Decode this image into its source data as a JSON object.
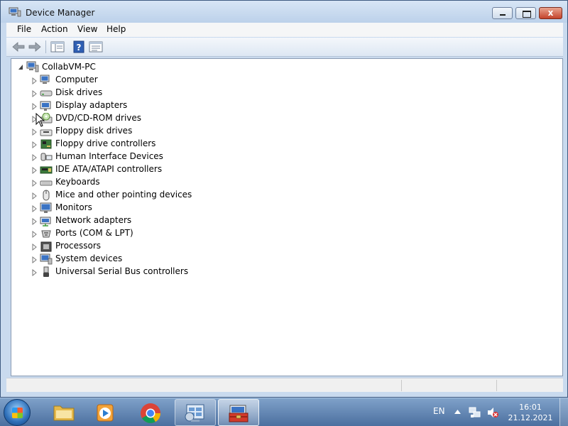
{
  "window": {
    "title": "Device Manager",
    "close_glyph": "x"
  },
  "menubar": {
    "items": [
      "File",
      "Action",
      "View",
      "Help"
    ]
  },
  "toolbar": {
    "icons": [
      "back-arrow-icon",
      "forward-arrow-icon",
      "show-hide-tree-icon",
      "help-icon",
      "properties-icon"
    ]
  },
  "tree": {
    "root": {
      "label": "CollabVM-PC",
      "icon": "computer-icon",
      "expanded": true
    },
    "categories": [
      {
        "label": "Computer",
        "icon": "computer-icon"
      },
      {
        "label": "Disk drives",
        "icon": "disk-drive-icon"
      },
      {
        "label": "Display adapters",
        "icon": "display-adapter-icon"
      },
      {
        "label": "DVD/CD-ROM drives",
        "icon": "dvd-drive-icon"
      },
      {
        "label": "Floppy disk drives",
        "icon": "floppy-disk-icon"
      },
      {
        "label": "Floppy drive controllers",
        "icon": "floppy-controller-icon"
      },
      {
        "label": "Human Interface Devices",
        "icon": "hid-icon"
      },
      {
        "label": "IDE ATA/ATAPI controllers",
        "icon": "ide-controller-icon"
      },
      {
        "label": "Keyboards",
        "icon": "keyboard-icon"
      },
      {
        "label": "Mice and other pointing devices",
        "icon": "mouse-icon"
      },
      {
        "label": "Monitors",
        "icon": "monitor-icon"
      },
      {
        "label": "Network adapters",
        "icon": "network-adapter-icon"
      },
      {
        "label": "Ports (COM & LPT)",
        "icon": "port-icon"
      },
      {
        "label": "Processors",
        "icon": "processor-icon"
      },
      {
        "label": "System devices",
        "icon": "system-device-icon"
      },
      {
        "label": "Universal Serial Bus controllers",
        "icon": "usb-icon"
      }
    ]
  },
  "taskbar": {
    "apps": [
      {
        "name": "windows-explorer",
        "icon": "folder-icon",
        "state": "pinned"
      },
      {
        "name": "media-player",
        "icon": "media-player-icon",
        "state": "pinned"
      },
      {
        "name": "chrome",
        "icon": "chrome-icon",
        "state": "pinned"
      },
      {
        "name": "control-panel",
        "icon": "control-panel-icon",
        "state": "open"
      },
      {
        "name": "device-manager",
        "icon": "toolbox-icon",
        "state": "active"
      }
    ],
    "language": "EN",
    "time": "16:01",
    "date": "21.12.2021"
  },
  "colors": {
    "window_frame": "#c9daee",
    "taskbar": "#4b6f9f",
    "close_button": "#c4432b"
  }
}
